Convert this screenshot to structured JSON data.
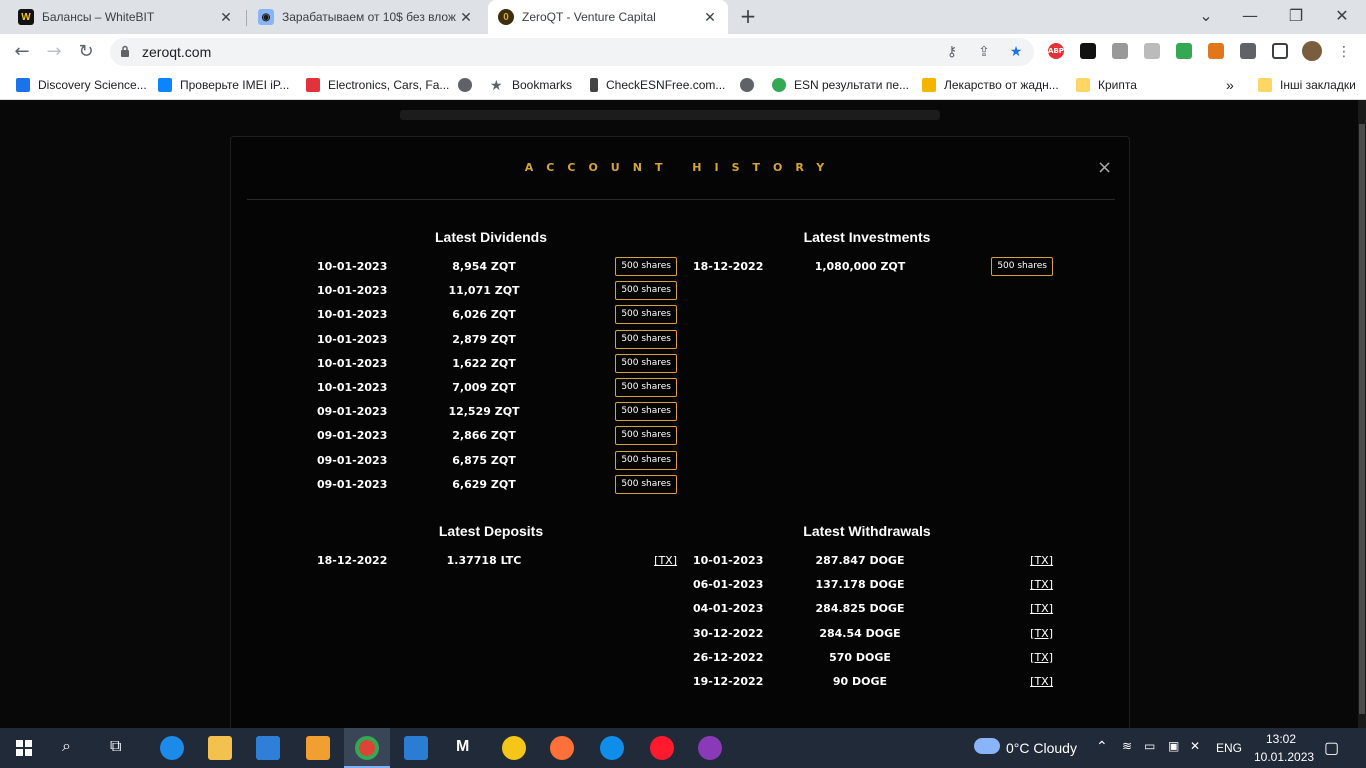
{
  "browser": {
    "tabs": [
      {
        "title": "Балансы – WhiteBIT",
        "icon": "whitebit-icon"
      },
      {
        "title": "Зарабатываем от 10$ без влож",
        "icon": "game-icon"
      },
      {
        "title": "ZeroQT - Venture Capital",
        "icon": "zeroqt-icon"
      }
    ],
    "new_tab": "+",
    "url": "zeroqt.com",
    "bookmarks": [
      {
        "label": "Discovery Science...",
        "icon_color": "#1a73e8"
      },
      {
        "label": "Проверьте IMEI iP...",
        "icon_color": "#0a84ff"
      },
      {
        "label": "Electronics, Cars, Fa...",
        "icon_color": "#e53238"
      },
      {
        "label": "",
        "icon_color": "#5f6368"
      },
      {
        "label": "Bookmarks",
        "icon_color": "#5f6368"
      },
      {
        "label": "CheckESNFree.com...",
        "icon_color": "#444"
      },
      {
        "label": "",
        "icon_color": "#5f6368"
      },
      {
        "label": "ESN результати пе...",
        "icon_color": "#34a853"
      },
      {
        "label": "Лекарство от жадн...",
        "icon_color": "#f4b400"
      },
      {
        "label": "Крипта",
        "icon_color": "#fdd663"
      }
    ],
    "more_bookmarks": "»",
    "other_bookmarks": "Інші закладки"
  },
  "modal": {
    "title": "ACCOUNT HISTORY",
    "close": "×",
    "dividends": {
      "title": "Latest Dividends",
      "rows": [
        {
          "date": "10-01-2023",
          "amount": "8,954 ZQT",
          "badge": "500 shares"
        },
        {
          "date": "10-01-2023",
          "amount": "11,071 ZQT",
          "badge": "500 shares"
        },
        {
          "date": "10-01-2023",
          "amount": "6,026 ZQT",
          "badge": "500 shares"
        },
        {
          "date": "10-01-2023",
          "amount": "2,879 ZQT",
          "badge": "500 shares"
        },
        {
          "date": "10-01-2023",
          "amount": "1,622 ZQT",
          "badge": "500 shares"
        },
        {
          "date": "10-01-2023",
          "amount": "7,009 ZQT",
          "badge": "500 shares"
        },
        {
          "date": "09-01-2023",
          "amount": "12,529 ZQT",
          "badge": "500 shares"
        },
        {
          "date": "09-01-2023",
          "amount": "2,866 ZQT",
          "badge": "500 shares"
        },
        {
          "date": "09-01-2023",
          "amount": "6,875 ZQT",
          "badge": "500 shares"
        },
        {
          "date": "09-01-2023",
          "amount": "6,629 ZQT",
          "badge": "500 shares"
        }
      ]
    },
    "investments": {
      "title": "Latest Investments",
      "rows": [
        {
          "date": "18-12-2022",
          "amount": "1,080,000 ZQT",
          "badge": "500 shares"
        }
      ]
    },
    "deposits": {
      "title": "Latest Deposits",
      "rows": [
        {
          "date": "18-12-2022",
          "amount": "1.37718 LTC",
          "tx": "[TX]"
        }
      ]
    },
    "withdrawals": {
      "title": "Latest Withdrawals",
      "rows": [
        {
          "date": "10-01-2023",
          "amount": "287.847 DOGE",
          "tx": "[TX]"
        },
        {
          "date": "06-01-2023",
          "amount": "137.178 DOGE",
          "tx": "[TX]"
        },
        {
          "date": "04-01-2023",
          "amount": "284.825 DOGE",
          "tx": "[TX]"
        },
        {
          "date": "30-12-2022",
          "amount": "284.54 DOGE",
          "tx": "[TX]"
        },
        {
          "date": "26-12-2022",
          "amount": "570 DOGE",
          "tx": "[TX]"
        },
        {
          "date": "19-12-2022",
          "amount": "90 DOGE",
          "tx": "[TX]"
        }
      ]
    }
  },
  "taskbar": {
    "weather": "0°C  Cloudy",
    "language": "ENG",
    "time": "13:02",
    "date": "10.01.2023"
  },
  "colors": {
    "accent": "#d4a43a",
    "modal_bg": "#050505",
    "taskbar": "#202a38"
  }
}
